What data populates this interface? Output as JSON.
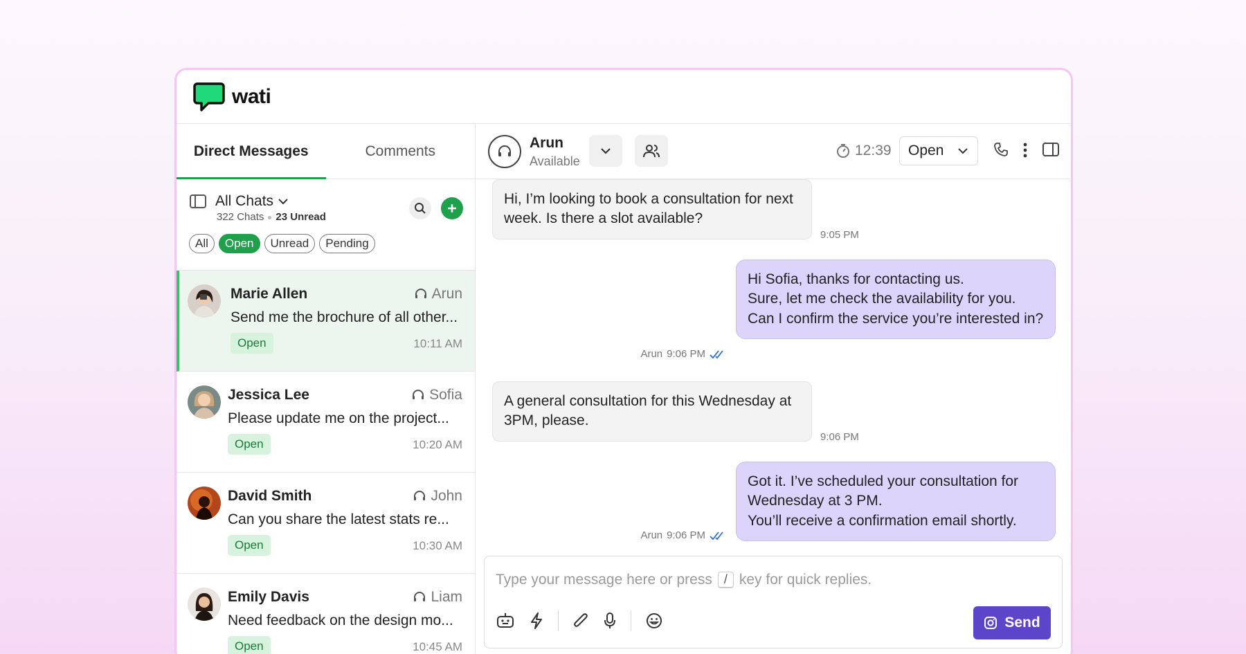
{
  "app": {
    "logo_text": "wati"
  },
  "tabs": [
    {
      "label": "Direct Messages"
    },
    {
      "label": "Comments"
    }
  ],
  "list": {
    "title": "All Chats",
    "count": "322 Chats",
    "unread": "23 Unread",
    "filters": [
      "All",
      "Open",
      "Unread",
      "Pending"
    ]
  },
  "conversations": [
    {
      "name": "Marie Allen",
      "agent": "Arun",
      "message": "Send me the brochure of all other...",
      "status": "Open",
      "time": "10:11 AM"
    },
    {
      "name": "Jessica Lee",
      "agent": "Sofia",
      "message": "Please update me on the project...",
      "status": "Open",
      "time": "10:20 AM"
    },
    {
      "name": "David Smith",
      "agent": "John",
      "message": "Can you share the latest stats re...",
      "status": "Open",
      "time": "10:30 AM"
    },
    {
      "name": "Emily Davis",
      "agent": "Liam",
      "message": "Need feedback on the design mo...",
      "status": "Open",
      "time": "10:45 AM"
    }
  ],
  "chat": {
    "agent_name": "Arun",
    "agent_status": "Available",
    "timer": "12:39",
    "status": "Open",
    "messages": [
      {
        "dir": "in",
        "text": "Hi, I’m looking to book a consultation for next week. Is there a slot available?",
        "time": "9:05 PM"
      },
      {
        "dir": "out",
        "text": "Hi Sofia, thanks for contacting us.\nSure, let me check the availability for you.\nCan I confirm the service you’re interested in?",
        "sender": "Arun",
        "time": "9:06 PM"
      },
      {
        "dir": "in",
        "text": "A general consultation for this Wednesday at 3PM, please.",
        "time": "9:06 PM"
      },
      {
        "dir": "out",
        "text": "Got it. I’ve scheduled your consultation for Wednesday at 3 PM.\nYou’ll receive a confirmation email shortly.",
        "sender": "Arun",
        "time": "9:06 PM"
      }
    ]
  },
  "composer": {
    "placeholder_before": "Type your message here or press",
    "key": "/",
    "placeholder_after": "key for quick replies.",
    "send_label": "Send"
  },
  "colors": {
    "brand_green": "#1fa04a",
    "send_purple": "#5d45c9",
    "outgoing_bubble": "#dcd4fb"
  }
}
